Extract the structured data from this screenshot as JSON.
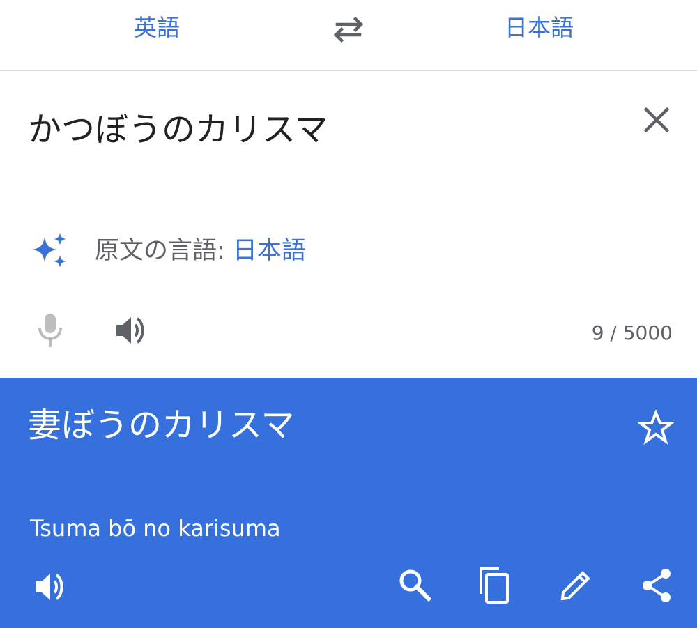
{
  "header": {
    "source_language": "英語",
    "target_language": "日本語",
    "swap_icon": "swap-arrows-icon"
  },
  "input": {
    "text": "かつぼうのカリスマ",
    "clear_icon": "close-icon",
    "detected_prefix": "原文の言語: ",
    "detected_language": "日本語",
    "detect_icon": "sparkle-icon",
    "mic_icon": "microphone-icon",
    "speaker_icon": "speaker-icon",
    "char_count": "9 / 5000"
  },
  "output": {
    "text": "妻ぼうのカリスマ",
    "romanization": "Tsuma bō no karisuma",
    "star_icon": "star-outline-icon",
    "speaker_icon": "speaker-icon",
    "search_icon": "search-icon",
    "copy_icon": "copy-icon",
    "edit_icon": "pencil-icon",
    "share_icon": "share-icon",
    "background_color": "#3570dc"
  },
  "colors": {
    "accent": "#3a72d6",
    "text_primary": "#202124",
    "text_secondary": "#5f6368"
  }
}
